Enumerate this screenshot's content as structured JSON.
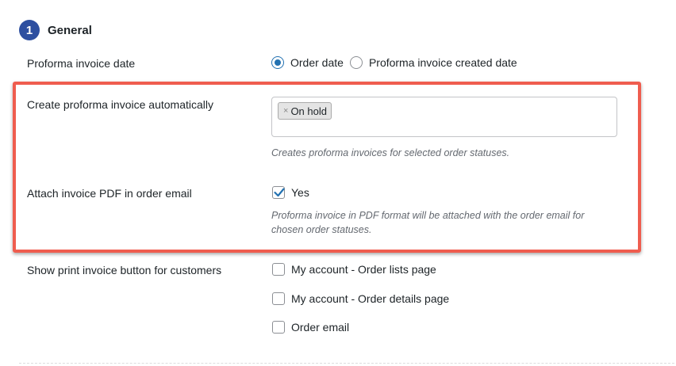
{
  "section": {
    "step_number": "1",
    "title": "General"
  },
  "proforma_date": {
    "label": "Proforma invoice date",
    "options": [
      {
        "label": "Order date",
        "checked": true
      },
      {
        "label": "Proforma invoice created date",
        "checked": false
      }
    ]
  },
  "auto_create": {
    "label": "Create proforma invoice automatically",
    "selected_tags": [
      "On hold"
    ],
    "chip_remove": "×",
    "description": "Creates proforma invoices for selected order statuses."
  },
  "attach_pdf": {
    "label": "Attach invoice PDF in order email",
    "checkbox_label": "Yes",
    "checked": true,
    "description_line1": "Proforma invoice in PDF format will be attached with the order email for",
    "description_line2": "chosen order statuses."
  },
  "print_button": {
    "label": "Show print invoice button for customers",
    "options": [
      {
        "label": "My account - Order lists page",
        "checked": false
      },
      {
        "label": "My account - Order details page",
        "checked": false
      },
      {
        "label": "Order email",
        "checked": false
      }
    ]
  },
  "colors": {
    "accent": "#2271b1",
    "badge": "#2d4fa0",
    "highlight": "#ef5d4f"
  }
}
